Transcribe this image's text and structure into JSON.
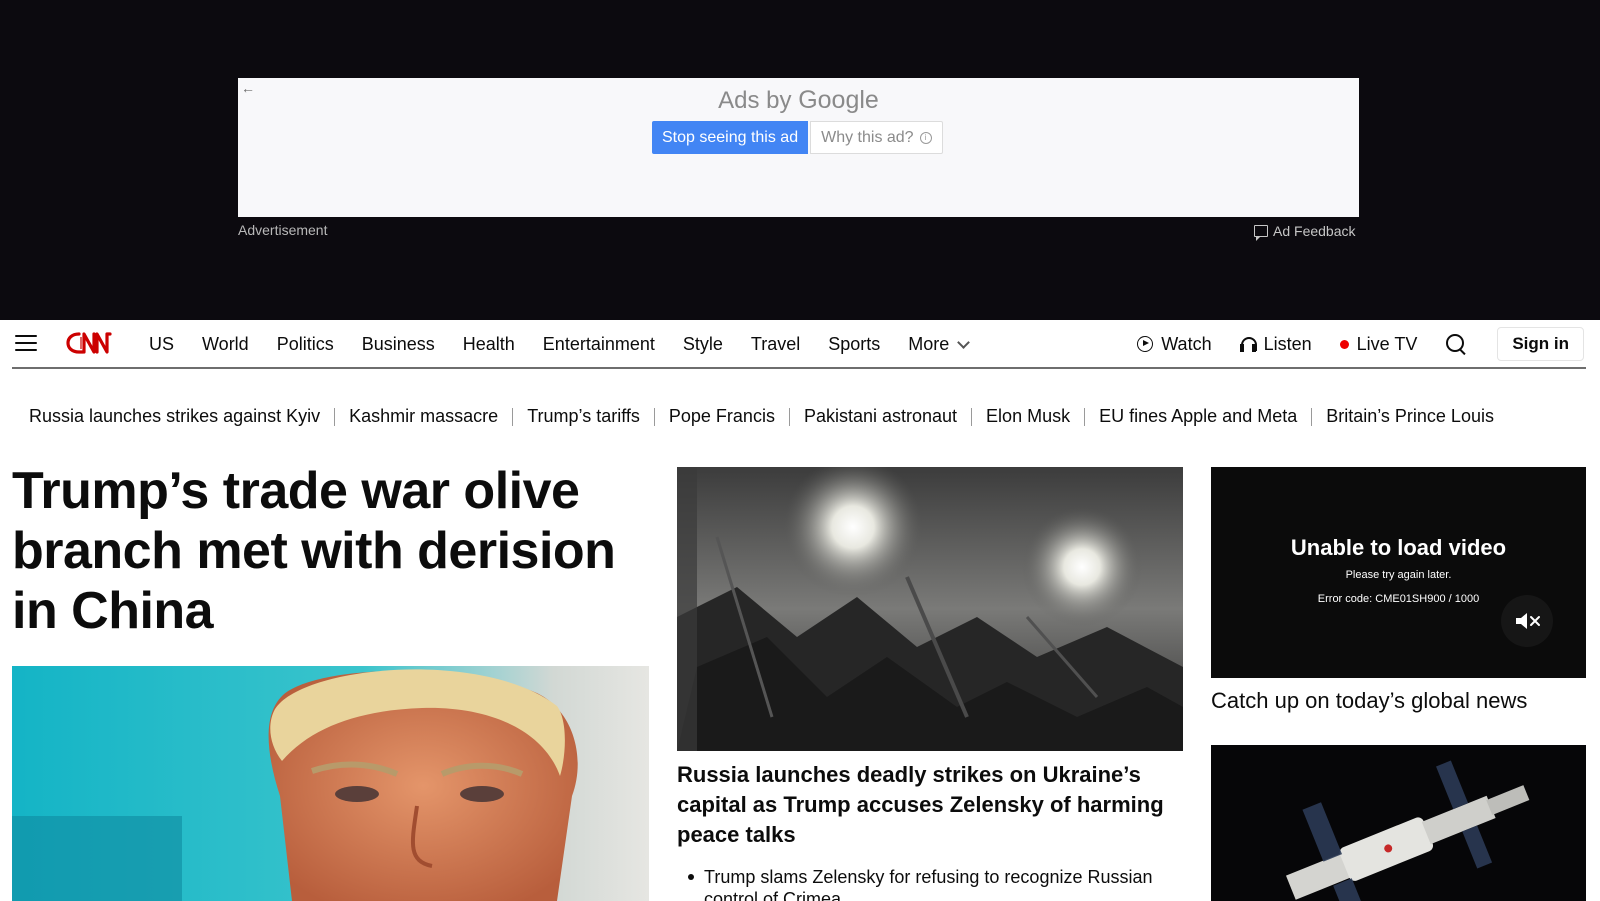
{
  "ad": {
    "ads_by": "Ads by",
    "ads_brand": "Google",
    "stop_label": "Stop seeing this ad",
    "why_label": "Why this ad?",
    "advertisement_label": "Advertisement",
    "feedback_label": "Ad Feedback"
  },
  "nav": {
    "items": [
      {
        "label": "US"
      },
      {
        "label": "World"
      },
      {
        "label": "Politics"
      },
      {
        "label": "Business"
      },
      {
        "label": "Health"
      },
      {
        "label": "Entertainment"
      },
      {
        "label": "Style"
      },
      {
        "label": "Travel"
      },
      {
        "label": "Sports"
      }
    ],
    "more_label": "More",
    "watch_label": "Watch",
    "listen_label": "Listen",
    "live_tv_label": "Live TV",
    "sign_in_label": "Sign in"
  },
  "trending": [
    "Russia launches strikes against Kyiv",
    "Kashmir massacre",
    "Trump’s tariffs",
    "Pope Francis",
    "Pakistani astronaut",
    "Elon Musk",
    "EU fines Apple and Meta",
    "Britain’s Prince Louis"
  ],
  "lead": {
    "headline": "Trump’s trade war olive branch met with derision in China"
  },
  "middle": {
    "headline": "Russia launches deadly strikes on Ukraine’s capital as Trump accuses Zelensky of harming peace talks",
    "bullet": "Trump slams Zelensky for refusing to recognize Russian control of Crimea"
  },
  "video": {
    "title": "Unable to load video",
    "subtitle": "Please try again later.",
    "error_code": "Error code: CME01SH900 / 1000",
    "caption": "Catch up on today’s global news"
  },
  "colors": {
    "ad_band": "#0c0a0f",
    "ad_button": "#4285f4",
    "cnn_red": "#cc0000",
    "live_dot": "#ee0000"
  }
}
